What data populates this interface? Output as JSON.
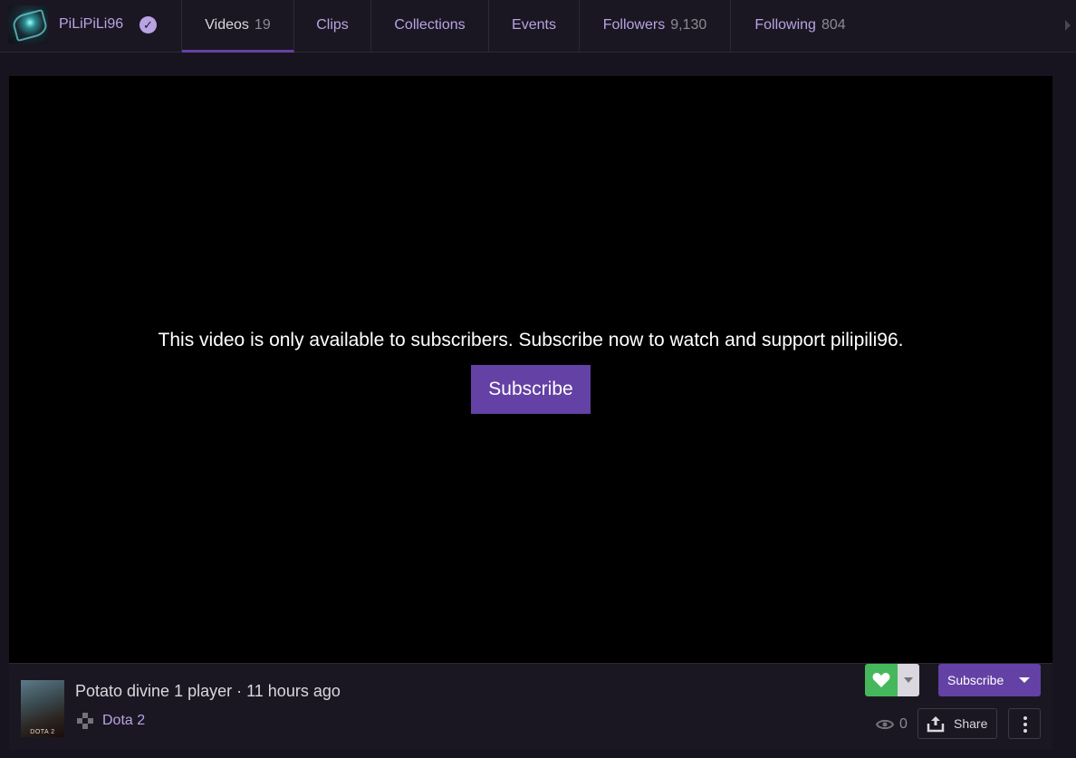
{
  "header": {
    "channel_name": "PiLiPiLi96",
    "tabs": [
      {
        "label": "Videos",
        "count": "19"
      },
      {
        "label": "Clips",
        "count": ""
      },
      {
        "label": "Collections",
        "count": ""
      },
      {
        "label": "Events",
        "count": ""
      },
      {
        "label": "Followers",
        "count": "9,130"
      },
      {
        "label": "Following",
        "count": "804"
      }
    ]
  },
  "player": {
    "message": "This video is only available to subscribers. Subscribe now to watch and support pilipili96.",
    "subscribe_label": "Subscribe"
  },
  "info": {
    "game_thumb_text": "DOTA 2",
    "title": "Potato divine 1 player · 11 hours ago",
    "game": "Dota 2",
    "subscribe_label": "Subscribe",
    "views": "0",
    "share_label": "Share"
  },
  "colors": {
    "accent": "#6441a4",
    "follow_green": "#45b85c",
    "link": "#b9a3e3",
    "background": "#17141f"
  }
}
